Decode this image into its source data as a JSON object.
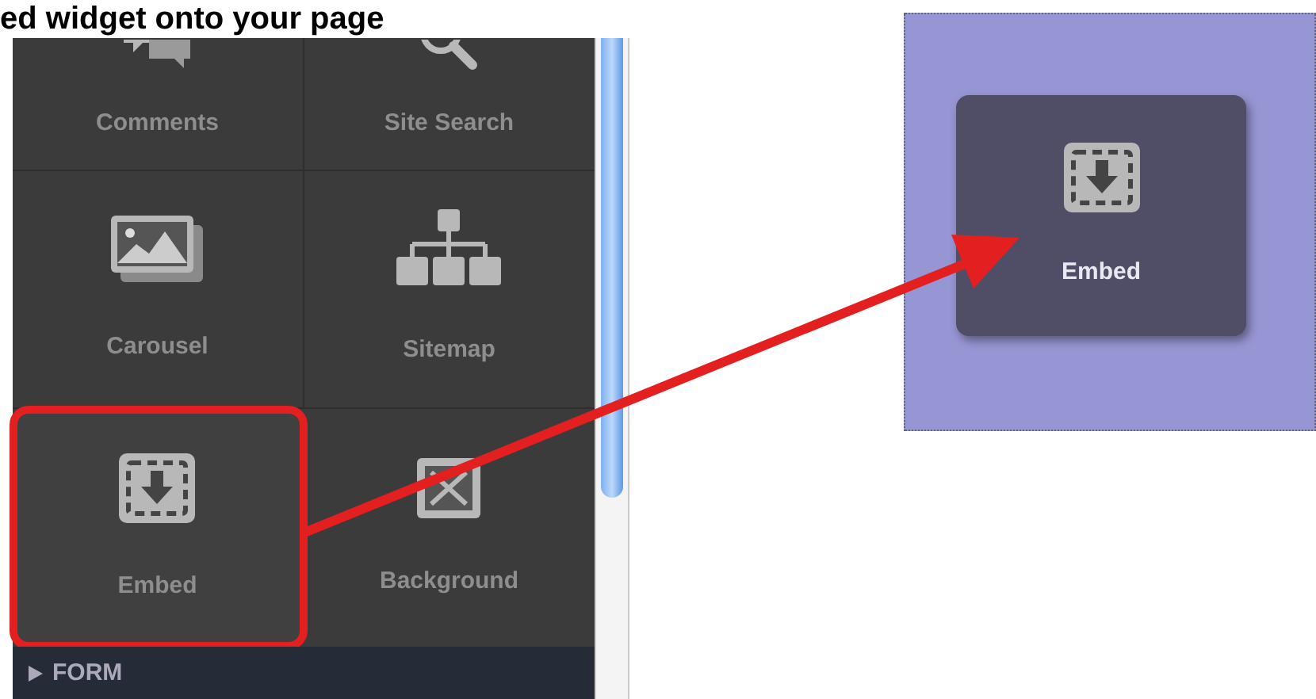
{
  "heading": "ed widget onto your page",
  "widgets": [
    {
      "kind": "comments",
      "label": "Comments",
      "selected": false
    },
    {
      "kind": "search",
      "label": "Site Search",
      "selected": false
    },
    {
      "kind": "carousel",
      "label": "Carousel",
      "selected": false
    },
    {
      "kind": "sitemap",
      "label": "Sitemap",
      "selected": false
    },
    {
      "kind": "embed",
      "label": "Embed",
      "selected": true
    },
    {
      "kind": "background",
      "label": "Background",
      "selected": false
    }
  ],
  "section": {
    "label": "FORM",
    "expanded": false
  },
  "dropped_widget": {
    "kind": "embed",
    "label": "Embed"
  }
}
